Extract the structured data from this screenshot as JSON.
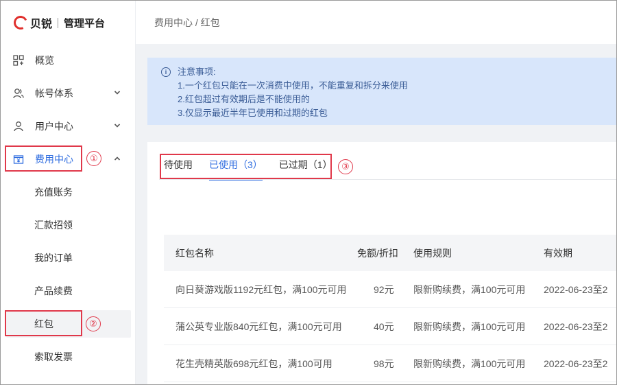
{
  "brand": {
    "name": "贝锐",
    "subtitle": "管理平台",
    "color": "#e0302d"
  },
  "sidebar": {
    "items": [
      {
        "label": "概览",
        "icon": "grid-icon"
      },
      {
        "label": "帐号体系",
        "icon": "users-icon"
      },
      {
        "label": "用户中心",
        "icon": "user-icon"
      },
      {
        "label": "费用中心",
        "icon": "yen-icon"
      }
    ],
    "sub_items": [
      {
        "label": "充值账务"
      },
      {
        "label": "汇款招领"
      },
      {
        "label": "我的订单"
      },
      {
        "label": "产品续费"
      },
      {
        "label": "红包"
      },
      {
        "label": "索取发票"
      }
    ]
  },
  "annotations": {
    "step1": "①",
    "step2": "②",
    "step3": "③",
    "color": "#e0384a"
  },
  "breadcrumb": "费用中心 / 红包",
  "notice": {
    "title": "注意事项:",
    "lines": [
      "1.一个红包只能在一次消费中使用，不能重复和拆分来使用",
      "2.红包超过有效期后是不能使用的",
      "3.仅显示最近半年已使用和过期的红包"
    ]
  },
  "tabs": [
    {
      "label": "待使用"
    },
    {
      "label": "已使用（3）"
    },
    {
      "label": "已过期（1）"
    }
  ],
  "table": {
    "headers": [
      "红包名称",
      "免额/折扣",
      "使用规则",
      "有效期"
    ],
    "rows": [
      [
        "向日葵游戏版1192元红包，满100元可用",
        "92元",
        "限新购续费，满100元可用",
        "2022-06-23至2"
      ],
      [
        "蒲公英专业版840元红包，满100元可用",
        "40元",
        "限新购续费，满100元可用",
        "2022-06-23至2"
      ],
      [
        "花生壳精英版698元红包，满100可用",
        "98元",
        "限新购续费，满100元可用",
        "2022-06-23至2"
      ]
    ]
  },
  "accent_color": "#2f6de0"
}
